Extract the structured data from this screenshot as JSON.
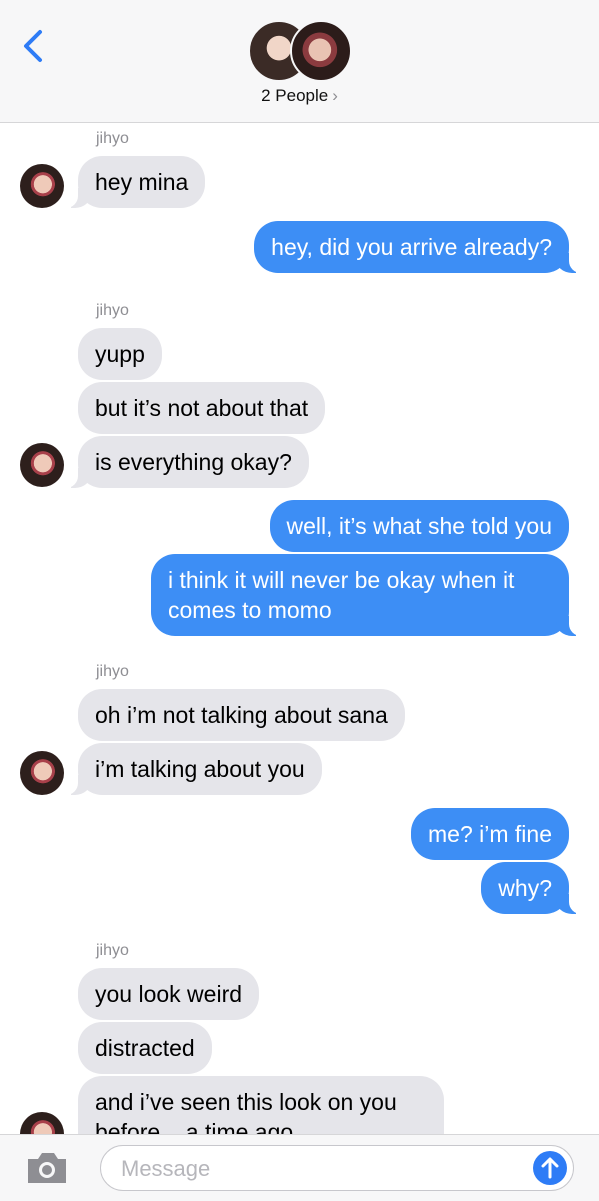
{
  "header": {
    "back_icon": "chevron-left-icon",
    "people_label": "2 People",
    "people_chevron": "›"
  },
  "thread": [
    {
      "sender": "jihyo"
    },
    {
      "from": "in",
      "text": "hey mina"
    },
    {
      "from": "out",
      "text": "hey, did you arrive already?"
    },
    {
      "sender": "jihyo"
    },
    {
      "from": "in",
      "text": "yupp"
    },
    {
      "from": "in",
      "text": "but it’s not about that"
    },
    {
      "from": "in",
      "text": "is everything okay?"
    },
    {
      "from": "out",
      "text": "well, it’s what she told you"
    },
    {
      "from": "out",
      "text": "i think it will never be okay when it comes to momo"
    },
    {
      "sender": "jihyo"
    },
    {
      "from": "in",
      "text": "oh i’m not talking about sana"
    },
    {
      "from": "in",
      "text": "i’m talking about you"
    },
    {
      "from": "out",
      "text": "me? i’m fine"
    },
    {
      "from": "out",
      "text": "why?"
    },
    {
      "sender": "jihyo"
    },
    {
      "from": "in",
      "text": "you look weird"
    },
    {
      "from": "in",
      "text": "distracted"
    },
    {
      "from": "in",
      "text": "and i’ve seen this look on you before... a time ago"
    }
  ],
  "composer": {
    "camera_icon": "camera-icon",
    "placeholder": "Message",
    "send_icon": "arrow-up-icon"
  },
  "colors": {
    "incoming_bubble": "#e5e5ea",
    "outgoing_bubble": "#3d8ef5",
    "accent": "#2e7cf6"
  }
}
